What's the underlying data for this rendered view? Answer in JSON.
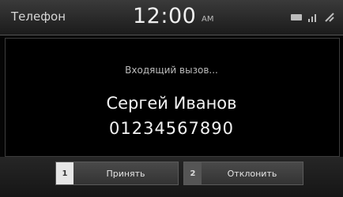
{
  "statusbar": {
    "app_title": "Телефон",
    "time": "12:00",
    "ampm": "AM",
    "icons": [
      "battery-icon",
      "signal-icon",
      "roaming-icon"
    ]
  },
  "call": {
    "status": "Входящий вызов...",
    "caller_name": "Сергей Иванов",
    "caller_number": "01234567890"
  },
  "actions": {
    "accept": {
      "index": "1",
      "label": "Принять"
    },
    "decline": {
      "index": "2",
      "label": "Отклонить"
    }
  },
  "colors": {
    "background": "#000000",
    "bar": "#262626",
    "text": "#f2f2f2"
  }
}
